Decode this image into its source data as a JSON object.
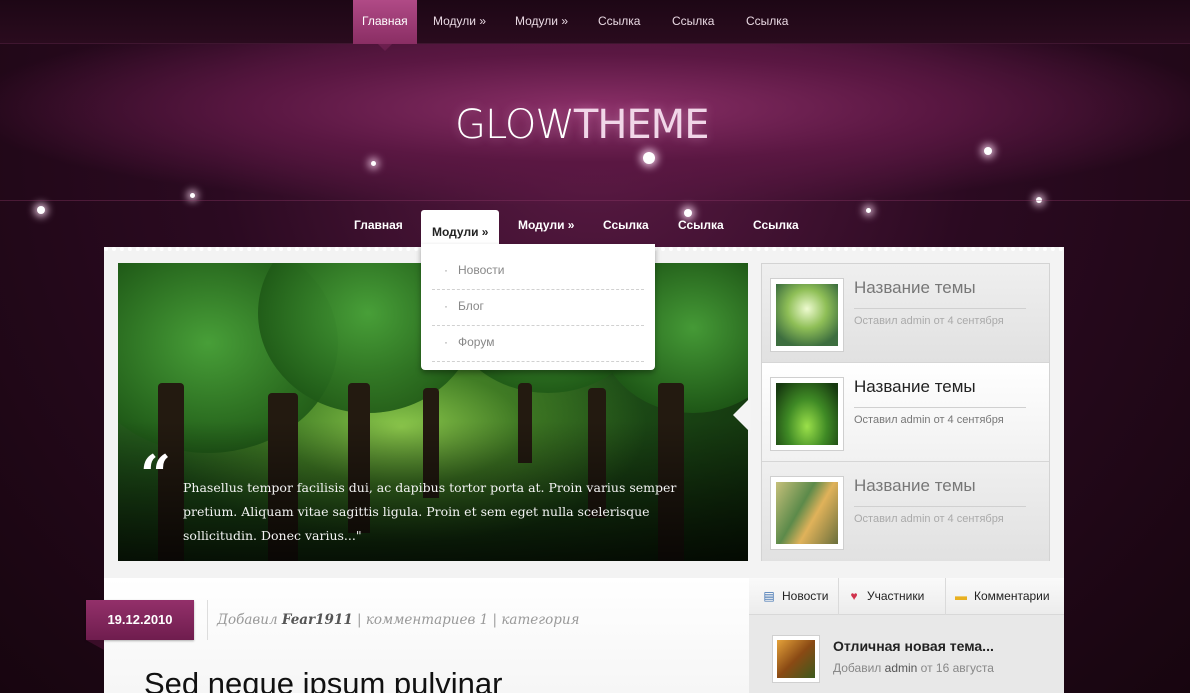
{
  "topnav": {
    "items": [
      {
        "label": "Главная",
        "active": true
      },
      {
        "label": "Модули »"
      },
      {
        "label": "Модули »"
      },
      {
        "label": "Ссылка"
      },
      {
        "label": "Ссылка"
      },
      {
        "label": "Ссылка"
      }
    ]
  },
  "header": {
    "logo_bold": "GLOW",
    "logo_light": "THEME"
  },
  "mainnav": {
    "items": [
      {
        "label": "Главная"
      },
      {
        "label": "Модули »",
        "active": true
      },
      {
        "label": "Модули »"
      },
      {
        "label": "Ссылка"
      },
      {
        "label": "Ссылка"
      },
      {
        "label": "Ссылка"
      }
    ],
    "dropdown": [
      "Новости",
      "Блог",
      "Форум"
    ]
  },
  "slider": {
    "quote_mark": "“",
    "quote": "Phasellus tempor facilisis dui, ac dapibus tortor porta at. Proin varius semper pretium. Aliquam vitae sagittis ligula. Proin et sem eget nulla scelerisque sollicitudin. Donec varius...\""
  },
  "featured": [
    {
      "title": "Название темы",
      "meta": "Оставил admin от 4 сентября"
    },
    {
      "title": "Название темы",
      "meta": "Оставил admin от 4 сентября",
      "active": true
    },
    {
      "title": "Название темы",
      "meta": "Оставил admin от 4 сентября"
    }
  ],
  "post": {
    "date": "19.12.2010",
    "meta_prefix": "Добавил",
    "author": "Fear1911",
    "comments": "| комментариев 1 | категория",
    "title": "Sed neque ipsum pulvinar"
  },
  "sidebar": {
    "tabs": [
      {
        "label": "Новости",
        "icon": "news-icon"
      },
      {
        "label": "Участники",
        "icon": "heart-icon"
      },
      {
        "label": "Комментарии",
        "icon": "comment-icon"
      }
    ],
    "item": {
      "title": "Отличная новая тема...",
      "meta_prefix": "Добавил",
      "author": "admin",
      "meta_suffix": "от 16 августа"
    }
  },
  "colors": {
    "accent": "#8a2e64",
    "background": "#2b0a21",
    "panel": "#f3f3f3"
  }
}
